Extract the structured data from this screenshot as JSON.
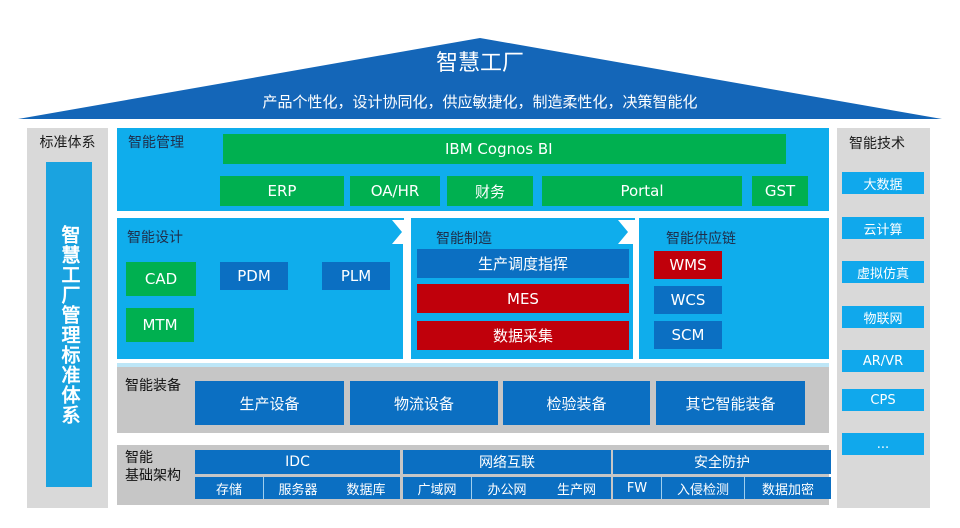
{
  "roof": {
    "title": "智慧工厂",
    "subtitle": "产品个性化，设计协同化，供应敏捷化，制造柔性化，决策智能化"
  },
  "standards": {
    "title": "标准体系",
    "vertical_label": "智慧工厂管理标准体系"
  },
  "technologies": {
    "title": "智能技术",
    "items": [
      "大数据",
      "云计算",
      "虚拟仿真",
      "物联网",
      "AR/VR",
      "CPS",
      "..."
    ]
  },
  "management": {
    "label": "智能管理",
    "top": "IBM Cognos BI",
    "items": [
      "ERP",
      "OA/HR",
      "财务",
      "Portal",
      "GST"
    ]
  },
  "design": {
    "label": "智能设计",
    "items": [
      "CAD",
      "PDM",
      "PLM",
      "MTM"
    ]
  },
  "manufacturing": {
    "label": "智能制造",
    "items": [
      "生产调度指挥",
      "MES",
      "数据采集"
    ]
  },
  "supply_chain": {
    "label": "智能供应链",
    "items": [
      "WMS",
      "WCS",
      "SCM"
    ]
  },
  "equipment": {
    "label": "智能装备",
    "items": [
      "生产设备",
      "物流设备",
      "检验装备",
      "其它智能装备"
    ]
  },
  "infrastructure": {
    "label_line1": "智能",
    "label_line2": "基础架构",
    "groups": [
      {
        "title": "IDC",
        "items": [
          "存储",
          "服务器",
          "数据库"
        ]
      },
      {
        "title": "网络互联",
        "items": [
          "广域网",
          "办公网",
          "生产网"
        ]
      },
      {
        "title": "安全防护",
        "items": [
          "FW",
          "入侵检测",
          "数据加密"
        ]
      }
    ]
  },
  "colors": {
    "roof_blue": "#1565c0",
    "section_blue": "#0fadec",
    "green": "#00b050",
    "dark_blue": "#0b6fc2",
    "red": "#c0000b",
    "gray": "#d9d9d9"
  }
}
